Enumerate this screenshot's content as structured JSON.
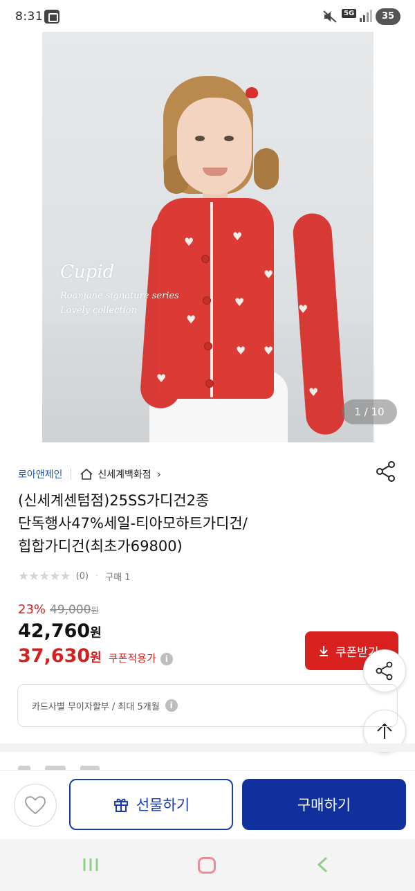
{
  "status_bar": {
    "time": "8:31",
    "network": "5G",
    "battery": "35",
    "app_icon": "gallery-icon",
    "mute_icon": "mute-icon"
  },
  "product_image": {
    "overlay_title": "Cupid",
    "overlay_line1": "Roanjane signature series",
    "overlay_line2": "Lovely collection",
    "counter": "1 / 10",
    "current_index": 1,
    "total": 10
  },
  "brand": {
    "name": "로아앤제인",
    "store_icon": "store-icon",
    "store_name": "신세계백화점",
    "store_chevron": "›",
    "share_icon": "share-icon"
  },
  "product": {
    "title_line1": "(신세계센텀점)25SS가디건2종",
    "title_line2": "단독행사47%세일-티아모하트가디건/",
    "title_line3": "힙합가디건(최초가69800)",
    "rating_stars": "★★★★★",
    "rating_value": 0,
    "rating_count": "(0)",
    "purchase_count": "구매 1"
  },
  "price": {
    "discount_pct": "23%",
    "original": "49,000",
    "original_unit": "원",
    "sale": "42,760",
    "sale_unit": "원",
    "coupon_price": "37,630",
    "coupon_unit": "원",
    "coupon_label": "쿠폰적용가",
    "info_glyph": "i"
  },
  "coupon_button": {
    "label": "쿠폰받기",
    "icon": "download-icon"
  },
  "card_info": {
    "text": "카드사별 무이자할부 / 최대 5개월",
    "info_glyph": "i"
  },
  "floating": {
    "share_icon": "share-icon",
    "top_icon": "arrow-up-icon"
  },
  "action_bar": {
    "wish_icon": "heart-icon",
    "gift_label": "선물하기",
    "gift_icon": "gift-icon",
    "buy_label": "구매하기"
  },
  "nav": {
    "recent_icon": "recent-apps-icon",
    "home_icon": "home-icon",
    "back_icon": "back-icon"
  },
  "colors": {
    "accent_red": "#d8211e",
    "brand_blue": "#10309e",
    "link_blue": "#2456a8"
  }
}
